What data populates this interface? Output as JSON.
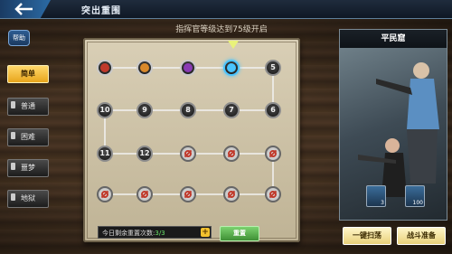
{
  "header": {
    "title": "突出重围"
  },
  "help_label": "帮助",
  "notice": "指挥官等级达到75级开启",
  "difficulties": [
    {
      "label": "简单",
      "selected": true
    },
    {
      "label": "普通",
      "selected": false
    },
    {
      "label": "困难",
      "selected": false
    },
    {
      "label": "噩梦",
      "selected": false
    },
    {
      "label": "地狱",
      "selected": false
    }
  ],
  "nodes": [
    {
      "label": "",
      "state": "avatar",
      "color": "#c0392b"
    },
    {
      "label": "",
      "state": "avatar",
      "color": "#d9892b"
    },
    {
      "label": "",
      "state": "avatar",
      "color": "#8a3bb5"
    },
    {
      "label": "",
      "state": "current",
      "color": "#49c4ff"
    },
    {
      "label": "5",
      "state": "numbered"
    },
    {
      "label": "10",
      "state": "numbered"
    },
    {
      "label": "9",
      "state": "numbered"
    },
    {
      "label": "8",
      "state": "numbered"
    },
    {
      "label": "7",
      "state": "numbered"
    },
    {
      "label": "6",
      "state": "numbered"
    },
    {
      "label": "11",
      "state": "numbered"
    },
    {
      "label": "12",
      "state": "numbered"
    },
    {
      "label": "",
      "state": "locked"
    },
    {
      "label": "",
      "state": "locked"
    },
    {
      "label": "",
      "state": "locked"
    },
    {
      "label": "",
      "state": "locked"
    },
    {
      "label": "",
      "state": "locked"
    },
    {
      "label": "",
      "state": "locked"
    },
    {
      "label": "",
      "state": "locked"
    },
    {
      "label": "",
      "state": "locked"
    }
  ],
  "reset": {
    "label": "今日剩余重置次数:",
    "count": "3/3",
    "button": "重置",
    "plus": "+"
  },
  "right_panel": {
    "title": "平民窟"
  },
  "rewards": [
    {
      "count": "3"
    },
    {
      "count": "100"
    }
  ],
  "actions": {
    "sweep": "一键扫荡",
    "prepare": "战斗准备"
  },
  "colors": {
    "selected_tab": "#f2c12e",
    "reset_button": "#4caf50",
    "accent": "#49c4ff"
  }
}
